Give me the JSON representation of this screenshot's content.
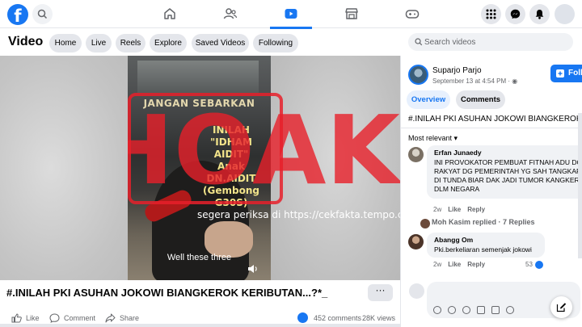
{
  "nav": {
    "logo": "f",
    "tabs": [
      "home-icon",
      "friends-icon",
      "video-icon",
      "marketplace-icon",
      "gaming-icon"
    ],
    "active_tab": "video-icon",
    "right_buttons": [
      "menu-grid-icon",
      "messenger-icon",
      "notifications-icon"
    ],
    "accent": "#1877f2"
  },
  "video_bar": {
    "title": "Video",
    "pills": [
      "Home",
      "Live",
      "Reels",
      "Explore",
      "Saved Videos",
      "Following"
    ],
    "search_placeholder": "Search videos"
  },
  "player": {
    "overlay_top": "JANGAN SEBARKAN",
    "overlay_claim_lines": [
      "INILAH",
      "\"IDHAM",
      "AIDIT\"",
      "Anak",
      "DN.AIDIT",
      "(Gembong",
      "G30S)"
    ],
    "caption": "Well these three",
    "stamp": "HOAKS",
    "verify_text": "segera periksa di https://cekfakta.tempo.co"
  },
  "post": {
    "title": "#.INILAH PKI ASUHAN JOKOWI BIANGKEROK KERIBUTAN...?*_",
    "more": "···",
    "actions": [
      "Like",
      "Comment",
      "Share"
    ],
    "comments_count": "452 comments",
    "views": "28K views"
  },
  "panel": {
    "author": "Suparjo Parjo",
    "date": "September 13 at 4:54 PM",
    "follow": "Follow",
    "tabs": [
      "Overview",
      "Comments"
    ],
    "post_text": "#.INILAH PKI ASUHAN JOKOWI BIANGKEROK KERIBUTAN",
    "sort": "Most relevant",
    "comments": [
      {
        "author": "Erfan Junaedy",
        "lines": [
          "INI PROVOKATOR PEMBUAT FITNAH ADU DOMBA",
          "RAKYAT DG PEMERINTAH YG SAH TANGKAP",
          "DI TUNDA BIAR DAK JADI TUMOR KANGKER",
          "DLM NEGARA"
        ],
        "time": "2w",
        "like": "Like",
        "reply": "Reply"
      },
      {
        "author": "Abangg Om",
        "lines": [
          "Pki.berkeliaran semenjak jokowi"
        ],
        "time": "2w",
        "like": "Like",
        "reply": "Reply",
        "reactions": "53"
      }
    ],
    "replies": "Moh Kasim replied · 7 Replies"
  }
}
